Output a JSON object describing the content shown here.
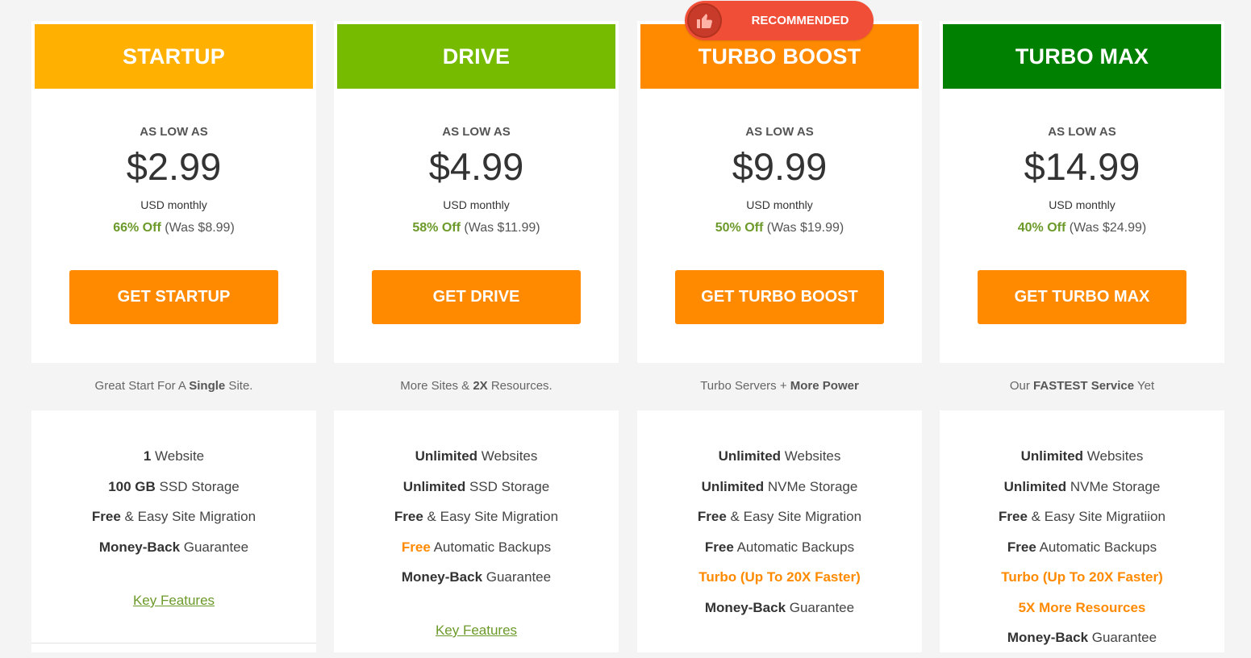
{
  "badge": {
    "label": "RECOMMENDED"
  },
  "colors": {
    "startup": "#ffb000",
    "drive": "#76bb00",
    "turbo_boost": "#ff8a00",
    "turbo_max": "#008000",
    "cta": "#ff8a00",
    "discount_green": "#6c9a2a",
    "badge_red": "#f04e37"
  },
  "plans": [
    {
      "name": "STARTUP",
      "as_low_as": "AS LOW AS",
      "price": "$2.99",
      "period": "USD monthly",
      "discount": "66% Off",
      "was": "(Was $8.99)",
      "cta": "GET STARTUP",
      "tagline_a": "Great Start For A ",
      "tagline_b": "Single",
      "tagline_c": " Site.",
      "features": [
        {
          "bold": "1",
          "text": " Website"
        },
        {
          "bold": "100 GB",
          "text": " SSD Storage"
        },
        {
          "bold": "Free",
          "text": " & Easy Site Migration"
        },
        {
          "bold": "Money-Back",
          "text": " Guarantee"
        }
      ],
      "key_features": "Key Features"
    },
    {
      "name": "DRIVE",
      "as_low_as": "AS LOW AS",
      "price": "$4.99",
      "period": "USD monthly",
      "discount": "58% Off",
      "was": "(Was $11.99)",
      "cta": "GET DRIVE",
      "tagline_a": "More Sites & ",
      "tagline_b": "2X",
      "tagline_c": " Resources.",
      "features": [
        {
          "bold": "Unlimited",
          "text": " Websites"
        },
        {
          "bold": "Unlimited",
          "text": " SSD Storage"
        },
        {
          "bold": "Free",
          "text": " & Easy Site Migration"
        },
        {
          "bold": "Free",
          "text": " Automatic Backups",
          "bold_orange": true
        },
        {
          "bold": "Money-Back",
          "text": " Guarantee"
        }
      ],
      "key_features": "Key Features"
    },
    {
      "name": "TURBO BOOST",
      "as_low_as": "AS LOW AS",
      "price": "$9.99",
      "period": "USD monthly",
      "discount": "50% Off",
      "was": "(Was $19.99)",
      "cta": "GET TURBO BOOST",
      "tagline_a": "Turbo Servers + ",
      "tagline_b": "More Power",
      "tagline_c": "",
      "features": [
        {
          "bold": "Unlimited",
          "text": " Websites"
        },
        {
          "bold": "Unlimited",
          "text": " NVMe Storage"
        },
        {
          "bold": "Free",
          "text": " & Easy Site Migration"
        },
        {
          "bold": "Free",
          "text": " Automatic Backups"
        },
        {
          "bold": "Turbo (Up To 20X Faster)",
          "text": "",
          "orange": true
        },
        {
          "bold": "Money-Back",
          "text": " Guarantee"
        }
      ]
    },
    {
      "name": "TURBO MAX",
      "as_low_as": "AS LOW AS",
      "price": "$14.99",
      "period": "USD monthly",
      "discount": "40% Off",
      "was": "(Was $24.99)",
      "cta": "GET TURBO MAX",
      "tagline_a": "Our ",
      "tagline_b": "FASTEST Service",
      "tagline_c": " Yet",
      "features": [
        {
          "bold": "Unlimited",
          "text": " Websites"
        },
        {
          "bold": "Unlimited",
          "text": " NVMe Storage"
        },
        {
          "bold": "Free",
          "text": " & Easy Site Migratiion"
        },
        {
          "bold": "Free",
          "text": " Automatic Backups"
        },
        {
          "bold": "Turbo (Up To 20X Faster)",
          "text": "",
          "orange": true
        },
        {
          "bold": "5X More Resources",
          "text": "",
          "orange": true
        },
        {
          "bold": "Money-Back",
          "text": " Guarantee"
        }
      ]
    }
  ]
}
